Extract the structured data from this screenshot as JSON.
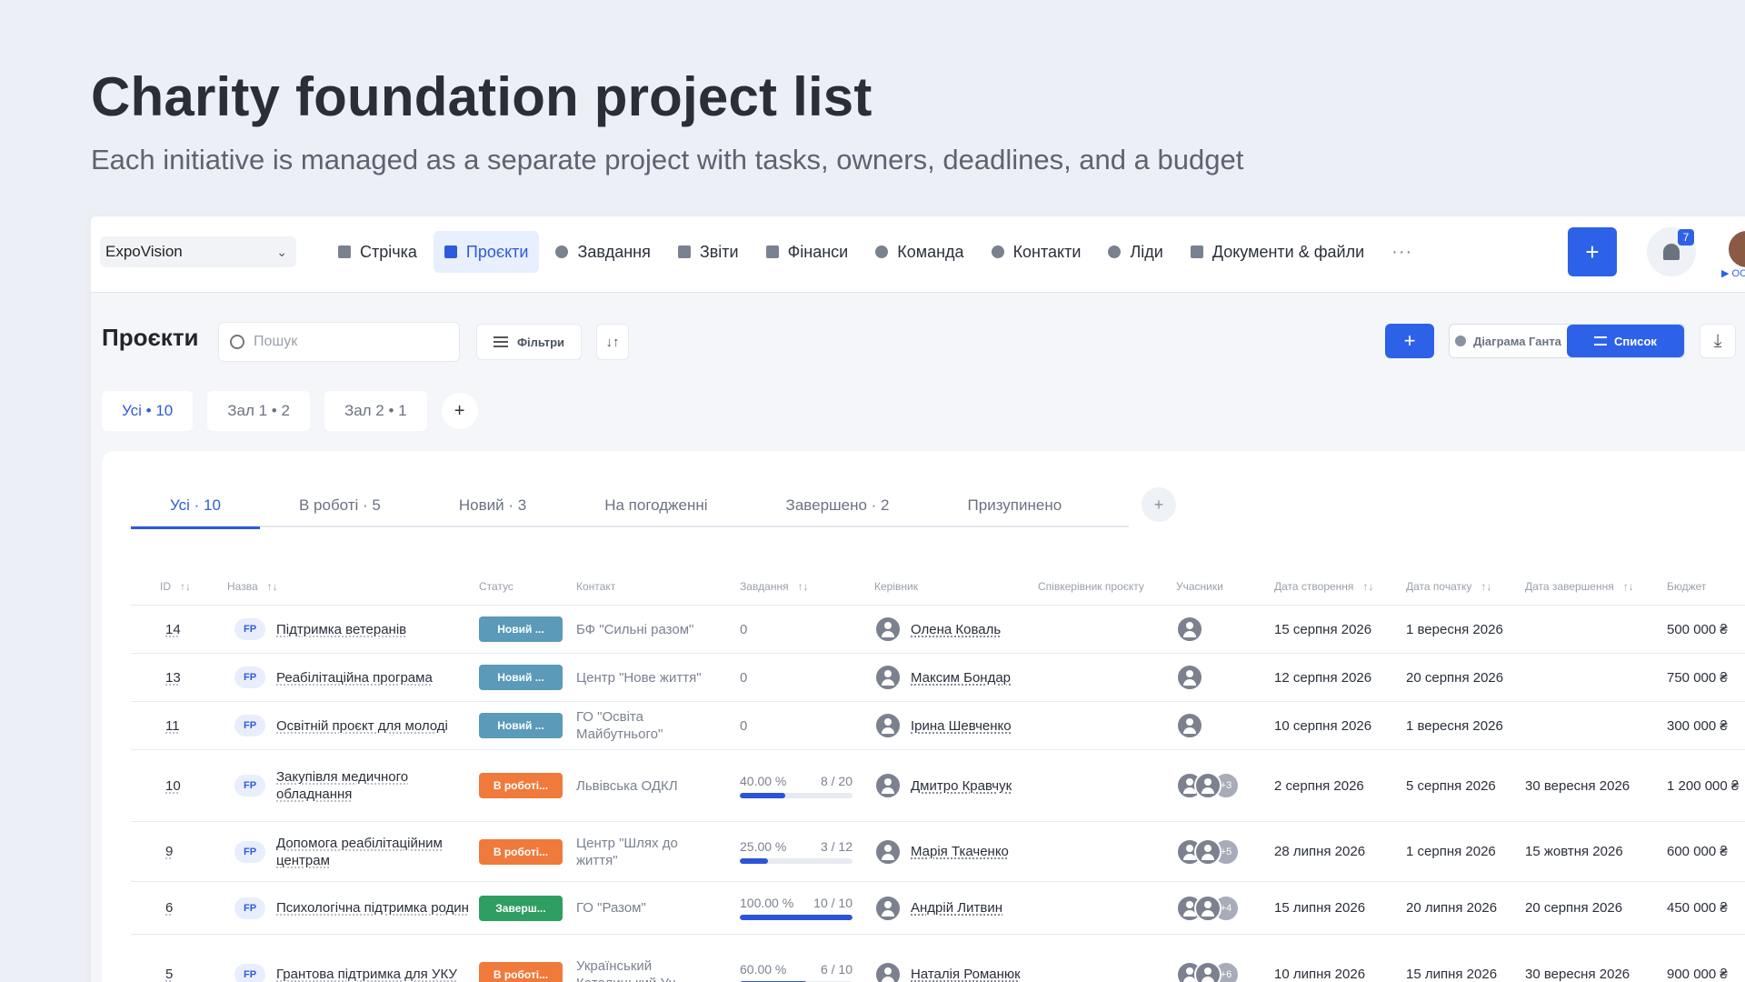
{
  "hero": {
    "title": "Charity foundation project list",
    "subtitle": "Each initiative is managed as a separate project with tasks, owners, deadlines, and a budget"
  },
  "topnav": {
    "org": "ExpoVision",
    "items": [
      {
        "label": "Стрічка",
        "icon": "home-icon"
      },
      {
        "label": "Проєкти",
        "icon": "file-icon",
        "active": true
      },
      {
        "label": "Завдання",
        "icon": "check-circle-icon"
      },
      {
        "label": "Звіти",
        "icon": "report-icon"
      },
      {
        "label": "Фінанси",
        "icon": "wallet-icon"
      },
      {
        "label": "Команда",
        "icon": "user-icon"
      },
      {
        "label": "Контакти",
        "icon": "contacts-icon"
      },
      {
        "label": "Ліди",
        "icon": "leads-icon"
      },
      {
        "label": "Документи & файли",
        "icon": "book-icon"
      }
    ],
    "more": "···",
    "add": "+",
    "notifications_count": "7",
    "avatar_tag": "▶ OC"
  },
  "toolbar": {
    "title": "Проєкти",
    "search_placeholder": "Пошук",
    "filters_label": "Фільтри",
    "sort_glyph": "↓↑",
    "add": "+",
    "view_gantt": "Діаграма Ганта",
    "view_list": "Список",
    "download_glyph": "⤓"
  },
  "saved_views": {
    "items": [
      "Усі • 10",
      "Зал 1 • 2",
      "Зал 2 • 1"
    ],
    "add": "+"
  },
  "status_tabs": {
    "items": [
      "Усі · 10",
      "В роботі · 5",
      "Новий · 3",
      "На погодженні",
      "Завершено · 2",
      "Призупинено"
    ],
    "add": "+"
  },
  "table": {
    "columns": {
      "id": "ID",
      "name": "Назва",
      "status": "Статус",
      "contact": "Контакт",
      "tasks": "Завдання",
      "manager": "Керівник",
      "co_manager": "Співкерівник проєкту",
      "participants": "Учасники",
      "created": "Дата створення",
      "start": "Дата початку",
      "end": "Дата завершення",
      "budget": "Бюджет"
    },
    "sort_glyph": "↑↓",
    "badge": "FP",
    "rows": [
      {
        "id": "14",
        "name": "Підтримка ветеранів",
        "status": "Новий ...",
        "status_color": "#5b9ab9",
        "contact": "БФ \"Сильні разом\"",
        "tasks": "0",
        "manager": "Олена Коваль",
        "participants_extra": "",
        "created": "15 серпня 2026",
        "start": "1 вересня 2026",
        "end": "",
        "budget": "500 000 ₴"
      },
      {
        "id": "13",
        "name": "Реабілітаційна програма",
        "status": "Новий ...",
        "status_color": "#5b9ab9",
        "contact": "Центр \"Нове життя\"",
        "tasks": "0",
        "manager": "Максим Бондар",
        "participants_extra": "",
        "created": "12 серпня 2026",
        "start": "20 серпня 2026",
        "end": "",
        "budget": "750 000 ₴"
      },
      {
        "id": "11",
        "name": "Освітній проєкт для молоді",
        "status": "Новий ...",
        "status_color": "#5b9ab9",
        "contact": "ГО \"Освіта Майбутнього\"",
        "tasks": "0",
        "manager": "Ірина Шевченко",
        "participants_extra": "",
        "created": "10 серпня 2026",
        "start": "1 вересня 2026",
        "end": "",
        "budget": "300 000 ₴"
      },
      {
        "id": "10",
        "name": "Закупівля медичного обладнання",
        "status": "В роботі...",
        "status_color": "#f07a3c",
        "contact": "Львівська ОДКЛ",
        "progress_pct": "40.00 %",
        "progress_frac": 0.4,
        "progress_count": "8 / 20",
        "manager": "Дмитро Кравчук",
        "participants_extra": "+3",
        "created": "2 серпня 2026",
        "start": "5 серпня 2026",
        "end": "30 вересня 2026",
        "budget": "1 200 000 ₴"
      },
      {
        "id": "9",
        "name": "Допомога реабілітаційним центрам",
        "status": "В роботі...",
        "status_color": "#f07a3c",
        "contact": "Центр \"Шлях до життя\"",
        "progress_pct": "25.00 %",
        "progress_frac": 0.25,
        "progress_count": "3 / 12",
        "manager": "Марія Ткаченко",
        "participants_extra": "+5",
        "created": "28 липня 2026",
        "start": "1 серпня 2026",
        "end": "15 жовтня 2026",
        "budget": "600 000 ₴"
      },
      {
        "id": "6",
        "name": "Психологічна підтримка родин",
        "status": "Заверш...",
        "status_color": "#2f9e62",
        "contact": "ГО \"Разом\"",
        "progress_pct": "100.00 %",
        "progress_frac": 1.0,
        "progress_count": "10 / 10",
        "manager": "Андрій Литвин",
        "participants_extra": "+4",
        "created": "15 липня 2026",
        "start": "20 липня 2026",
        "end": "20 серпня 2026",
        "budget": "450 000 ₴"
      },
      {
        "id": "5",
        "name": "Грантова підтримка для УКУ",
        "status": "В роботі...",
        "status_color": "#f07a3c",
        "contact": "Український Католицький Ун...",
        "progress_pct": "60.00 %",
        "progress_frac": 0.6,
        "progress_count": "6 / 10",
        "manager": "Наталія Романюк",
        "participants_extra": "+6",
        "created": "10 липня 2026",
        "start": "15 липня 2026",
        "end": "30 вересня 2026",
        "budget": "900 000 ₴"
      }
    ]
  },
  "colors": {
    "accent": "#2d62e8",
    "status_new": "#5b9ab9",
    "status_in_progress": "#f07a3c",
    "status_done": "#2f9e62"
  }
}
